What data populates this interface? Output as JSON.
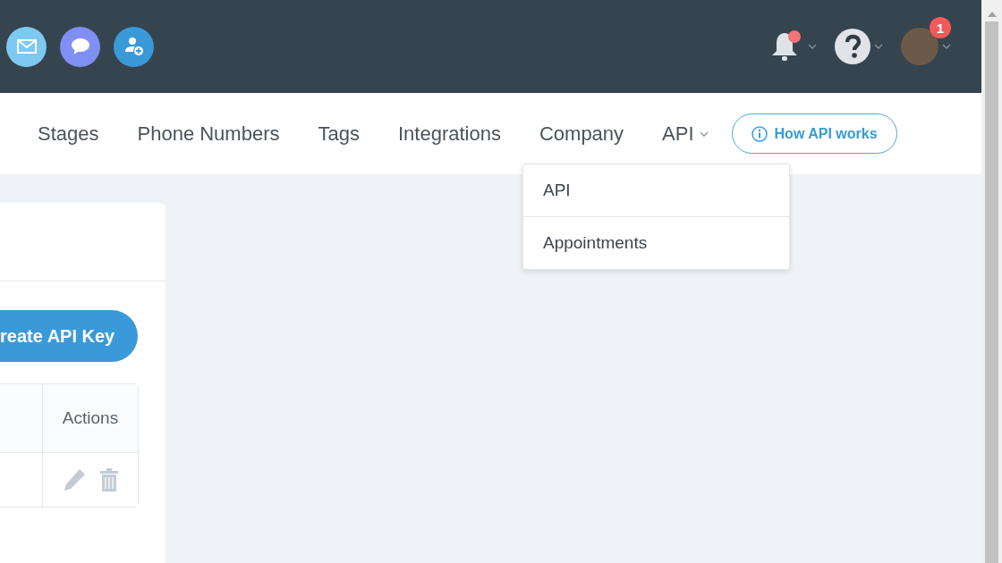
{
  "header": {
    "quick_actions": [
      {
        "kind": "email"
      },
      {
        "kind": "chat"
      },
      {
        "kind": "add-contact"
      }
    ],
    "notifications": {
      "unread": true
    },
    "help": {
      "kind": "question"
    },
    "profile": {
      "badge": "1"
    }
  },
  "nav": {
    "items": [
      {
        "label": "Stages",
        "kind": "link"
      },
      {
        "label": "Phone Numbers",
        "kind": "link"
      },
      {
        "label": "Tags",
        "kind": "link"
      },
      {
        "label": "Integrations",
        "kind": "link"
      },
      {
        "label": "Company",
        "kind": "link"
      },
      {
        "label": "API",
        "kind": "dropdown"
      }
    ],
    "dropdown": {
      "expanded": true,
      "items": [
        "API",
        "Appointments"
      ]
    },
    "help_button": {
      "label": "How API works"
    }
  },
  "card": {
    "create_button": {
      "label": "reate API Key"
    },
    "table": {
      "columns": [
        "Actions"
      ],
      "rows": [
        {
          "actions": [
            {
              "kind": "edit"
            },
            {
              "kind": "delete"
            }
          ]
        }
      ]
    }
  }
}
